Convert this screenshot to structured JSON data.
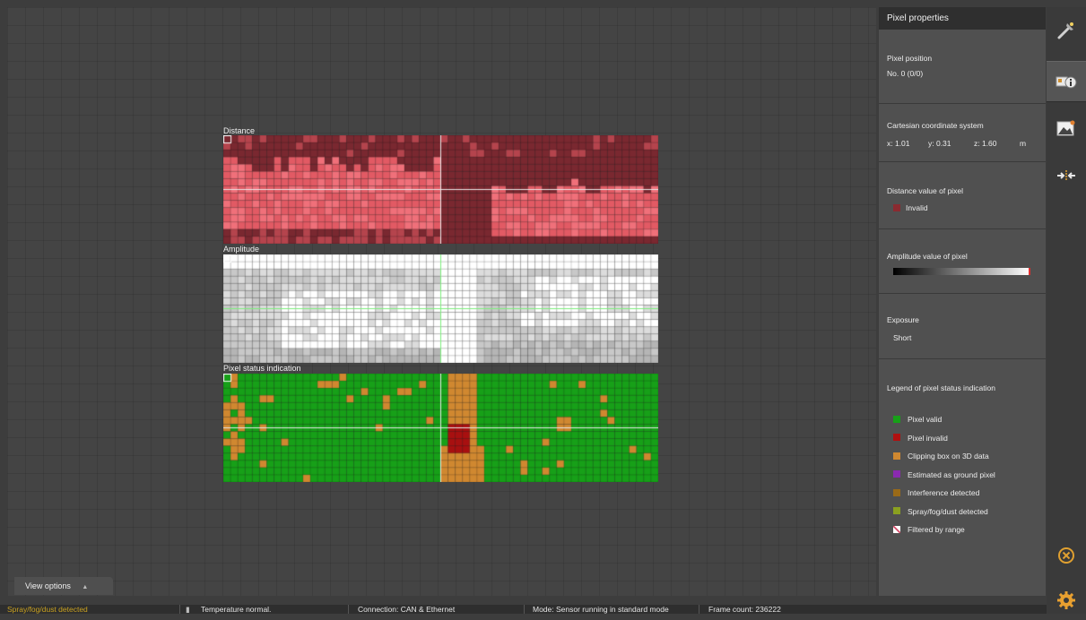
{
  "images": {
    "distance": {
      "label": "Distance",
      "colors": {
        "dark": "#7a2830",
        "mid": "#b5444d",
        "light": "#e25a64",
        "bright": "#f0707a"
      }
    },
    "amplitude": {
      "label": "Amplitude",
      "colors": {
        "white": "#ffffff",
        "light": "#dcdcdc",
        "mid": "#c8c8c8",
        "dark": "#b5b5b5"
      }
    },
    "status": {
      "label": "Pixel status indication",
      "colors": {
        "valid": "#17a018",
        "invalid": "#a81010",
        "clipping": "#d08830"
      }
    },
    "crosshair_color": "#e8e8e8",
    "amplitude_crosshair_color": "#7df07d"
  },
  "panel": {
    "title": "Pixel properties",
    "pixel_position": {
      "title": "Pixel position",
      "value": "No. 0  (0/0)"
    },
    "cartesian": {
      "title": "Cartesian coordinate system",
      "x": "x: 1.01",
      "y": "y: 0.31",
      "z": "z: 1.60",
      "unit": "m"
    },
    "distance": {
      "title": "Distance value of pixel",
      "value": "Invalid",
      "color": "#8b2a30"
    },
    "amplitude": {
      "title": "Amplitude value of pixel",
      "marker_color": "#e03030"
    },
    "exposure": {
      "title": "Exposure",
      "value": "Short"
    },
    "legend": {
      "title": "Legend of pixel status indication",
      "items": [
        {
          "label": "Pixel valid",
          "color": "#17a018"
        },
        {
          "label": "Pixel invalid",
          "color": "#b01010"
        },
        {
          "label": "Clipping box on 3D data",
          "color": "#d08830"
        },
        {
          "label": "Estimated as ground pixel",
          "color": "#8a2ab0"
        },
        {
          "label": "Interference detected",
          "color": "#9a6a18"
        },
        {
          "label": "Spray/fog/dust detected",
          "color": "#8aa020"
        },
        {
          "label": "Filtered by range",
          "color": "#e8e8e8"
        }
      ]
    }
  },
  "toolbar": {
    "icons": [
      "wrench-icon",
      "pixel-info-icon",
      "image-icon",
      "compare-arrows-icon",
      "close-circle-icon",
      "gear-icon"
    ]
  },
  "view_options": {
    "label": "View options",
    "arrow": "▲"
  },
  "statusbar": {
    "spray": "Spray/fog/dust detected",
    "spray_color": "#c8a020",
    "temperature": "Temperature normal.",
    "connection": "Connection: CAN & Ethernet",
    "mode": "Mode: Sensor running in standard mode",
    "frame": "Frame count: 236222"
  }
}
